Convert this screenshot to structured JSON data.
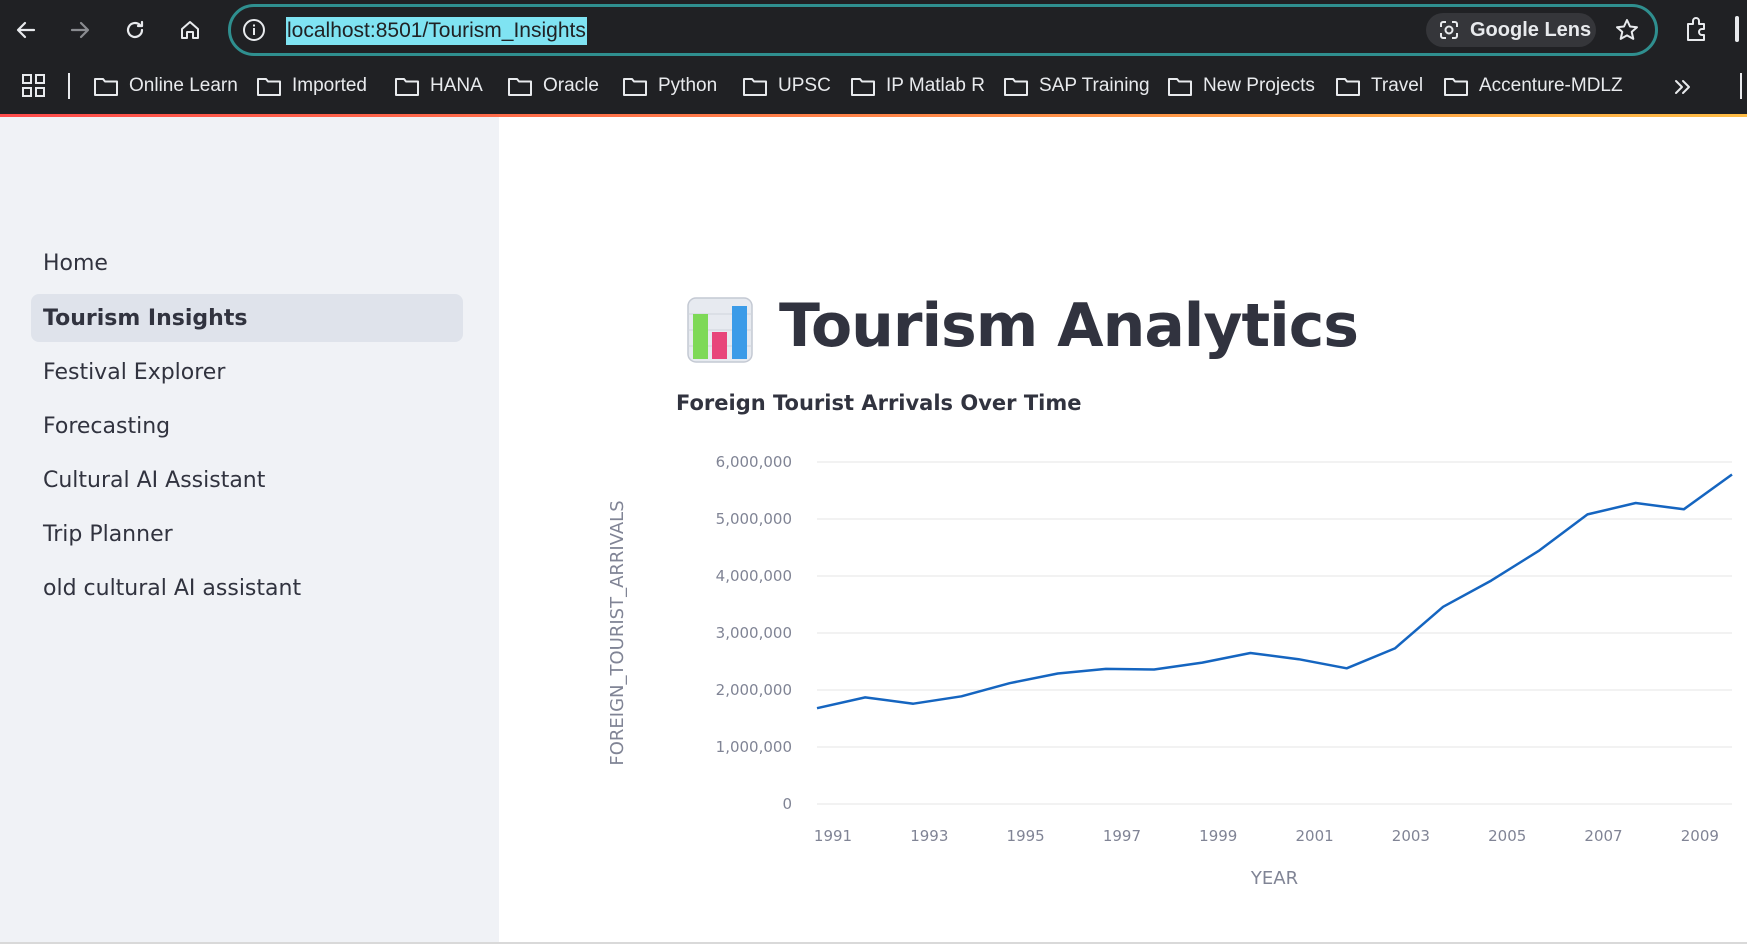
{
  "browser": {
    "url": "localhost:8501/Tourism_Insights",
    "lens_label": "Google Lens",
    "bookmarks": [
      "Online Learn",
      "Imported",
      "HANA",
      "Oracle",
      "Python",
      "UPSC",
      "IP Matlab R",
      "SAP Training",
      "New Projects",
      "Travel",
      "Accenture-MDLZ"
    ]
  },
  "sidebar": {
    "items": [
      {
        "label": "Home",
        "active": false
      },
      {
        "label": "Tourism Insights",
        "active": true
      },
      {
        "label": "Festival Explorer",
        "active": false
      },
      {
        "label": "Forecasting",
        "active": false
      },
      {
        "label": "Cultural AI Assistant",
        "active": false
      },
      {
        "label": "Trip Planner",
        "active": false
      },
      {
        "label": "old cultural AI assistant",
        "active": false
      }
    ]
  },
  "page": {
    "title_icon": "bar-chart-emoji-icon",
    "title": "Tourism Analytics",
    "chart_title": "Foreign Tourist Arrivals Over Time"
  },
  "colors": {
    "line": "#1565c0",
    "grid": "#e6e6e6",
    "sidebar_bg": "#f0f2f6",
    "url_highlight": "#7fe3f2"
  },
  "chart_data": {
    "type": "line",
    "title": "Foreign Tourist Arrivals Over Time",
    "xlabel": "YEAR",
    "ylabel": "FOREIGN_TOURIST_ARRIVALS",
    "x": [
      1991,
      1992,
      1993,
      1994,
      1995,
      1996,
      1997,
      1998,
      1999,
      2000,
      2001,
      2002,
      2003,
      2004,
      2005,
      2006,
      2007,
      2008,
      2009,
      2010
    ],
    "series": [
      {
        "values": [
          1680000,
          1870000,
          1760000,
          1890000,
          2120000,
          2290000,
          2370000,
          2360000,
          2480000,
          2650000,
          2540000,
          2380000,
          2730000,
          3460000,
          3920000,
          4450000,
          5080000,
          5280000,
          5170000,
          5780000
        ]
      }
    ],
    "xticks": [
      "1991",
      "1993",
      "1995",
      "1997",
      "1999",
      "2001",
      "2003",
      "2005",
      "2007",
      "2009"
    ],
    "yticks": [
      "0",
      "1,000,000",
      "2,000,000",
      "3,000,000",
      "4,000,000",
      "5,000,000",
      "6,000,000"
    ],
    "ylim": [
      0,
      6000000
    ],
    "xlim": [
      1991,
      2010
    ],
    "grid": true
  }
}
